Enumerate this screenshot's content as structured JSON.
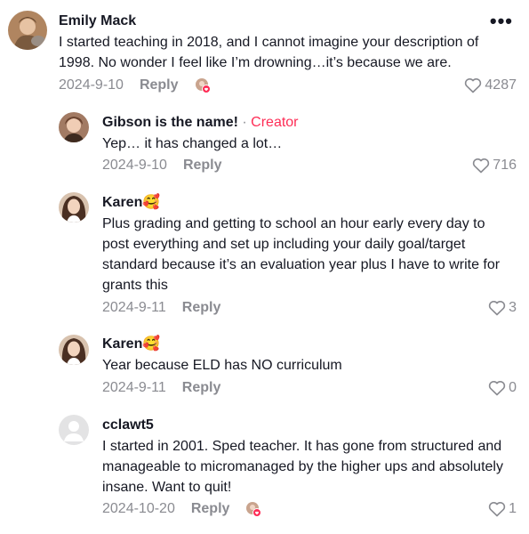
{
  "comments": [
    {
      "name": "Emily Mack",
      "text": "I started teaching in 2018, and I cannot imagine your description of 1998. No wonder I feel like I’m drowning…it’s because we are.",
      "date": "2024-9-10",
      "reply": "Reply",
      "likes": "4287",
      "more": "•••"
    },
    {
      "name": "Gibson is the name!",
      "separator": "·",
      "creator_badge": "Creator",
      "text": "Yep… it has changed a lot…",
      "date": "2024-9-10",
      "reply": "Reply",
      "likes": "716"
    },
    {
      "name": "Karen🥰",
      "text": "Plus grading and getting to school an hour early every day to post everything and set up including your daily goal/target standard because it’s an evaluation year plus I have to write for grants this",
      "date": "2024-9-11",
      "reply": "Reply",
      "likes": "3"
    },
    {
      "name": "Karen🥰",
      "text": "Year because ELD has NO curriculum",
      "date": "2024-9-11",
      "reply": "Reply",
      "likes": "0"
    },
    {
      "name": "cclawt5",
      "text": "I started in 2001. Sped teacher. It has gone from structured and manageable to micromanaged by the higher ups and absolutely insane. Want to quit!",
      "date": "2024-10-20",
      "reply": "Reply",
      "likes": "1"
    }
  ],
  "icons": {
    "like": "heart-outline-icon",
    "more": "more-horizontal-icon",
    "liked_by_creator": "creator-liked-avatar-icon"
  },
  "colors": {
    "creator_accent": "#fe2c55",
    "muted_text": "#8a8b91"
  }
}
